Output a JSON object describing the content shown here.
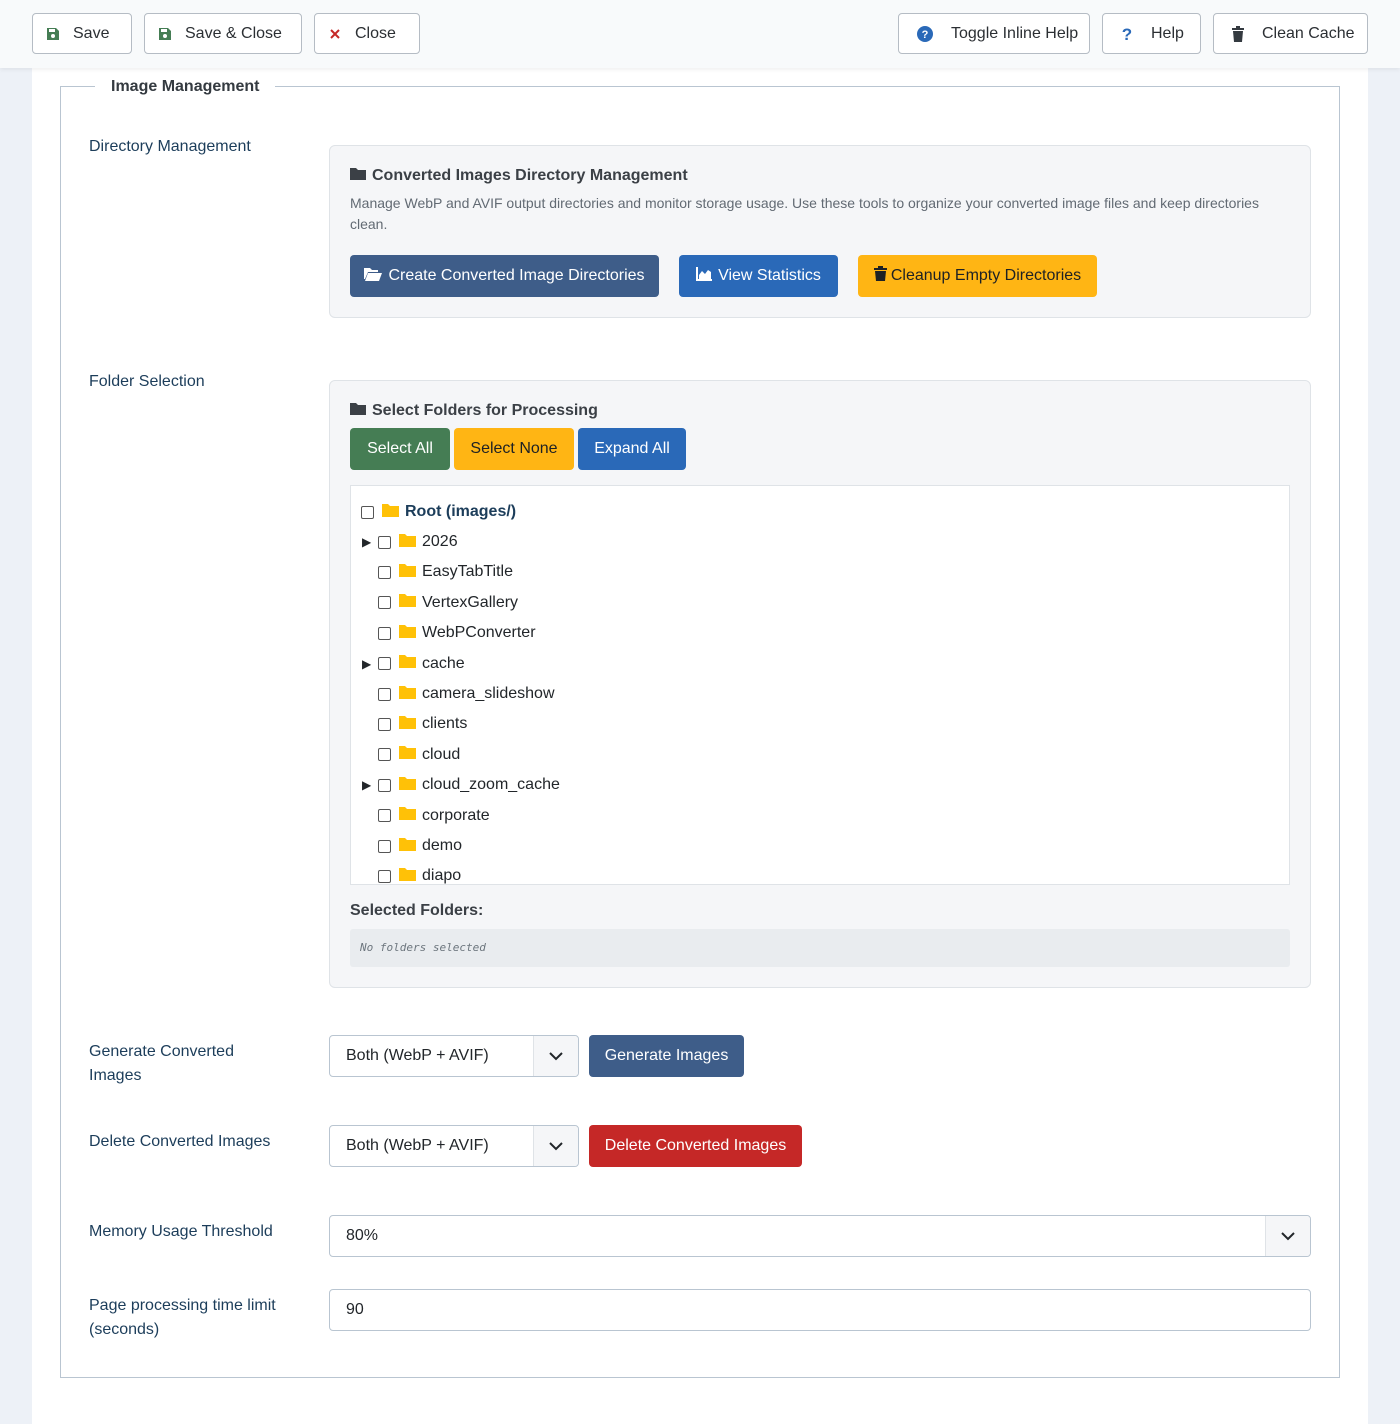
{
  "toolbar": {
    "save_label": "Save",
    "save_close_label": "Save & Close",
    "close_label": "Close",
    "toggle_help_label": "Toggle Inline Help",
    "help_label": "Help",
    "clean_cache_label": "Clean Cache"
  },
  "fieldset": {
    "legend": "Image Management"
  },
  "directory_management": {
    "label": "Directory Management",
    "card_title": "Converted Images Directory Management",
    "card_desc": "Manage WebP and AVIF output directories and monitor storage usage. Use these tools to organize your converted image files and keep directories clean.",
    "create_btn": "Create Converted Image Directories",
    "stats_btn": "View Statistics",
    "cleanup_btn": "Cleanup Empty Directories"
  },
  "folder_selection": {
    "label": "Folder Selection",
    "card_title": "Select Folders for Processing",
    "select_all": "Select All",
    "select_none": "Select None",
    "expand_all": "Expand All",
    "root": "Root (images/)",
    "folders": [
      {
        "name": "2026",
        "expandable": true
      },
      {
        "name": "EasyTabTitle",
        "expandable": false
      },
      {
        "name": "VertexGallery",
        "expandable": false
      },
      {
        "name": "WebPConverter",
        "expandable": false
      },
      {
        "name": "cache",
        "expandable": true
      },
      {
        "name": "camera_slideshow",
        "expandable": false
      },
      {
        "name": "clients",
        "expandable": false
      },
      {
        "name": "cloud",
        "expandable": false
      },
      {
        "name": "cloud_zoom_cache",
        "expandable": true
      },
      {
        "name": "corporate",
        "expandable": false
      },
      {
        "name": "demo",
        "expandable": false
      },
      {
        "name": "diapo",
        "expandable": false
      }
    ],
    "selected_label": "Selected Folders:",
    "selected_value": "No folders selected"
  },
  "generate": {
    "label": "Generate Converted Images",
    "select_value": "Both (WebP + AVIF)",
    "button": "Generate Images"
  },
  "delete": {
    "label": "Delete Converted Images",
    "select_value": "Both (WebP + AVIF)",
    "button": "Delete Converted Images"
  },
  "memory": {
    "label": "Memory Usage Threshold",
    "value": "80%"
  },
  "time_limit": {
    "label": "Page processing time limit (seconds)",
    "value": "90"
  },
  "colors": {
    "primary": "#3e5d89",
    "blue": "#2a69b8",
    "warning": "#ffb514",
    "success": "#457d54",
    "danger": "#c52827",
    "folder": "#ffc107"
  }
}
